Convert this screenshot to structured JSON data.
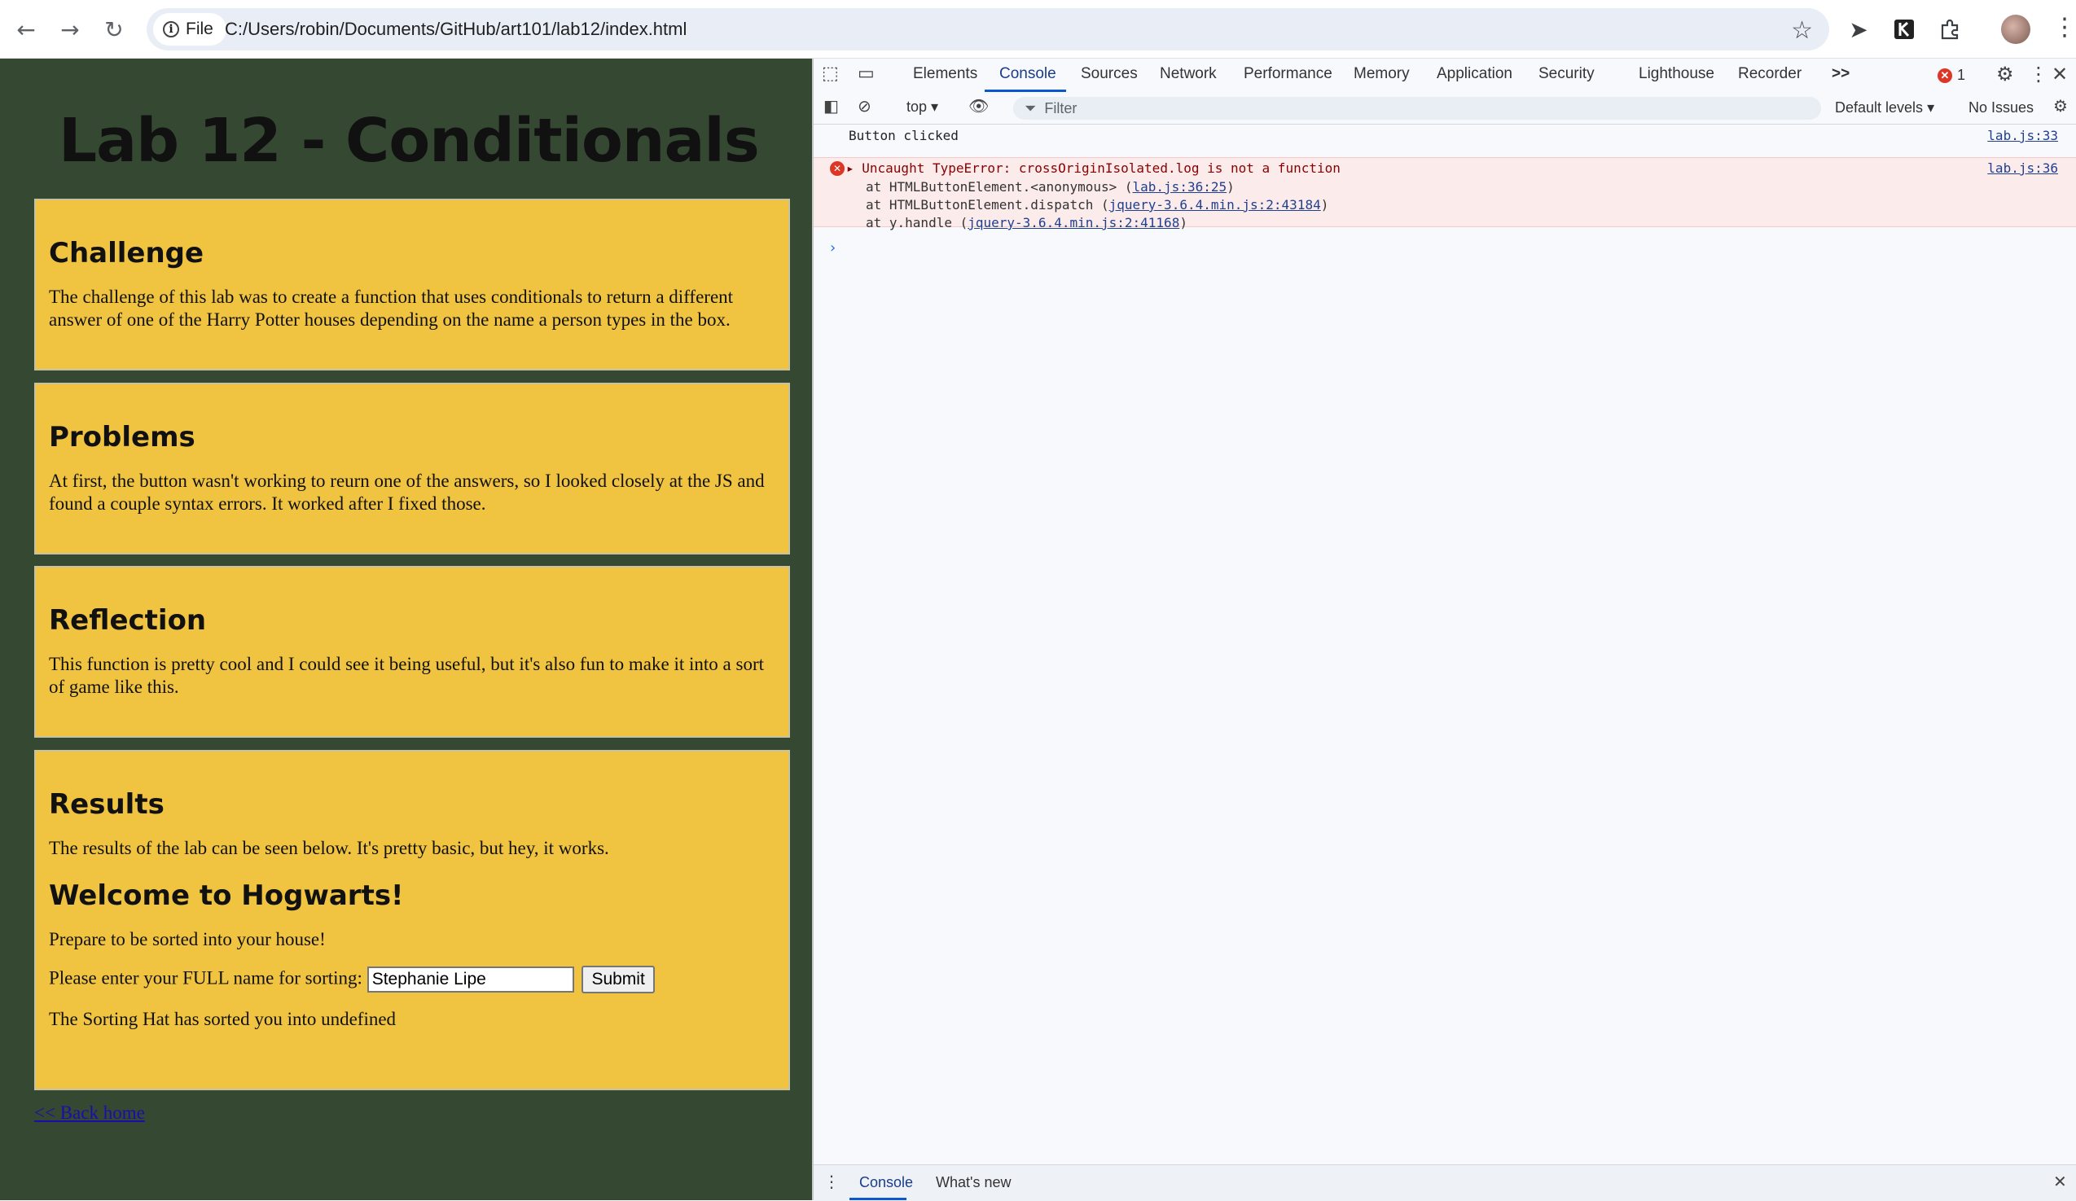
{
  "browser": {
    "back_icon": "arrow-left-icon",
    "forward_icon": "arrow-right-icon",
    "reload_icon": "reload-icon",
    "site_info_label": "File",
    "url": "C:/Users/robin/Documents/GitHub/art101/lab12/index.html"
  },
  "page": {
    "title": "Lab 12 - Conditionals",
    "challenge": {
      "heading": "Challenge",
      "text": "The challenge of this lab was to create a function that uses conditionals to return a different answer of one of the Harry Potter houses depending on the name a person types in the box."
    },
    "problems": {
      "heading": "Problems",
      "text": "At first, the button wasn't working to reurn one of the answers, so I looked closely at the JS and found a couple syntax errors. It worked after I fixed those."
    },
    "reflection": {
      "heading": "Reflection",
      "text": "This function is pretty cool and I could see it being useful, but it's also fun to make it into a sort of game like this."
    },
    "results": {
      "heading": "Results",
      "text": "The results of the lab can be seen below. It's pretty basic, but hey, it works.",
      "welcome_heading": "Welcome to Hogwarts!",
      "prepare_text": "Prepare to be sorted into your house!",
      "prompt_label": "Please enter your FULL name for sorting:",
      "name_value": "Stephanie Lipe",
      "submit_label": "Submit",
      "output_text": "The Sorting Hat has sorted you into undefined"
    },
    "back_link": "<< Back home"
  },
  "devtools": {
    "tabs": [
      "Elements",
      "Console",
      "Sources",
      "Network",
      "Performance",
      "Memory",
      "Application",
      "Security",
      "Lighthouse",
      "Recorder"
    ],
    "more_tabs": ">>",
    "error_count": "1",
    "context": "top",
    "filter_placeholder": "Filter",
    "default_levels": "Default levels",
    "no_issues": "No Issues",
    "log": {
      "text": "Button clicked",
      "source": "lab.js:33"
    },
    "error": {
      "message": "Uncaught TypeError: crossOriginIsolated.log is not a function",
      "source": "lab.js:36",
      "stack": [
        {
          "prefix": "at HTMLButtonElement.<anonymous> (",
          "link": "lab.js:36:25",
          "suffix": ")"
        },
        {
          "prefix": "at HTMLButtonElement.dispatch (",
          "link": "jquery-3.6.4.min.js:2:43184",
          "suffix": ")"
        },
        {
          "prefix": "at y.handle (",
          "link": "jquery-3.6.4.min.js:2:41168",
          "suffix": ")"
        }
      ]
    },
    "drawer_tabs": [
      "Console",
      "What's new"
    ]
  }
}
